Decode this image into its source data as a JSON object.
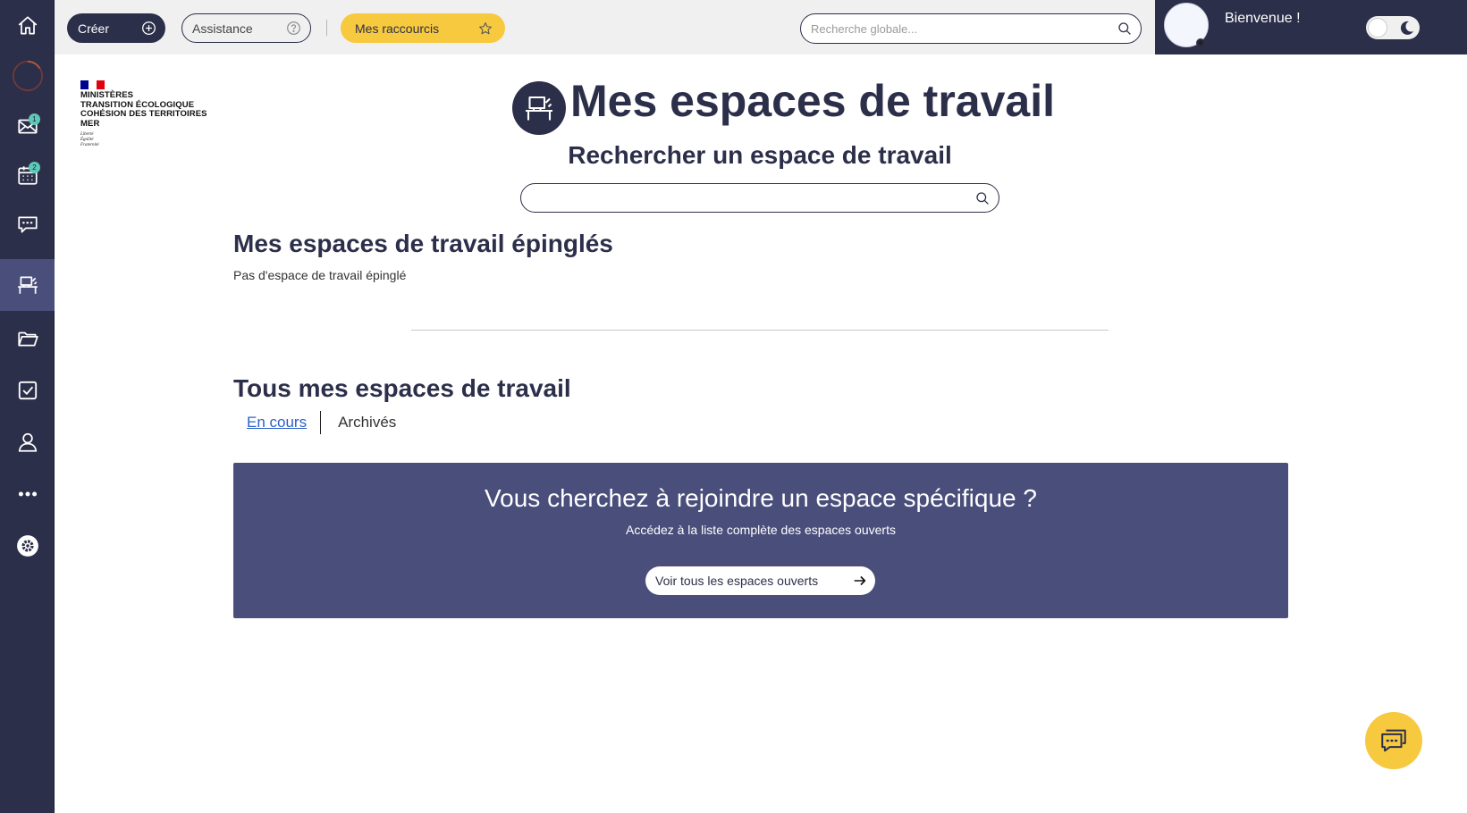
{
  "sidebar": {
    "items": [
      {
        "name": "home",
        "icon": "home-icon"
      },
      {
        "name": "refresh",
        "icon": "loading-circle-icon"
      },
      {
        "name": "mail",
        "icon": "mail-icon",
        "badge": "1"
      },
      {
        "name": "calendar",
        "icon": "calendar-icon",
        "badge": "2"
      },
      {
        "name": "chat",
        "icon": "chat-icon"
      },
      {
        "name": "workspaces",
        "icon": "workspace-icon",
        "active": true
      },
      {
        "name": "files",
        "icon": "folder-icon"
      },
      {
        "name": "tasks",
        "icon": "checkbox-icon"
      },
      {
        "name": "profile",
        "icon": "user-icon"
      },
      {
        "name": "more",
        "icon": "more-icon"
      },
      {
        "name": "settings",
        "icon": "settings-icon"
      }
    ]
  },
  "topbar": {
    "create_label": "Créer",
    "assistance_label": "Assistance",
    "shortcuts_label": "Mes raccourcis",
    "search_placeholder": "Recherche globale..."
  },
  "user": {
    "welcome": "Bienvenue !"
  },
  "logo": {
    "line1": "MINISTÈRES",
    "line2": "TRANSITION ÉCOLOGIQUE",
    "line3": "COHÉSION DES TERRITOIRES",
    "line4": "MER",
    "motto1": "Liberté",
    "motto2": "Égalité",
    "motto3": "Fraternité"
  },
  "main": {
    "title": "Mes espaces de travail",
    "search_heading": "Rechercher un espace de travail",
    "search_value": "",
    "pinned_heading": "Mes espaces de travail épinglés",
    "pinned_empty": "Pas d'espace de travail épinglé",
    "all_heading": "Tous mes espaces de travail",
    "tabs": [
      {
        "label": "En cours",
        "active": true
      },
      {
        "label": "Archivés",
        "active": false
      }
    ]
  },
  "banner": {
    "title": "Vous cherchez à rejoindre un espace spécifique ?",
    "subtitle": "Accédez à la liste complète des espaces ouverts",
    "button_label": "Voir tous les espaces ouverts"
  },
  "colors": {
    "navy": "#2c2f4a",
    "active": "#4a4e7b",
    "yellow": "#f7c93f",
    "badge": "#5fc9b9",
    "link": "#2d62c9"
  }
}
